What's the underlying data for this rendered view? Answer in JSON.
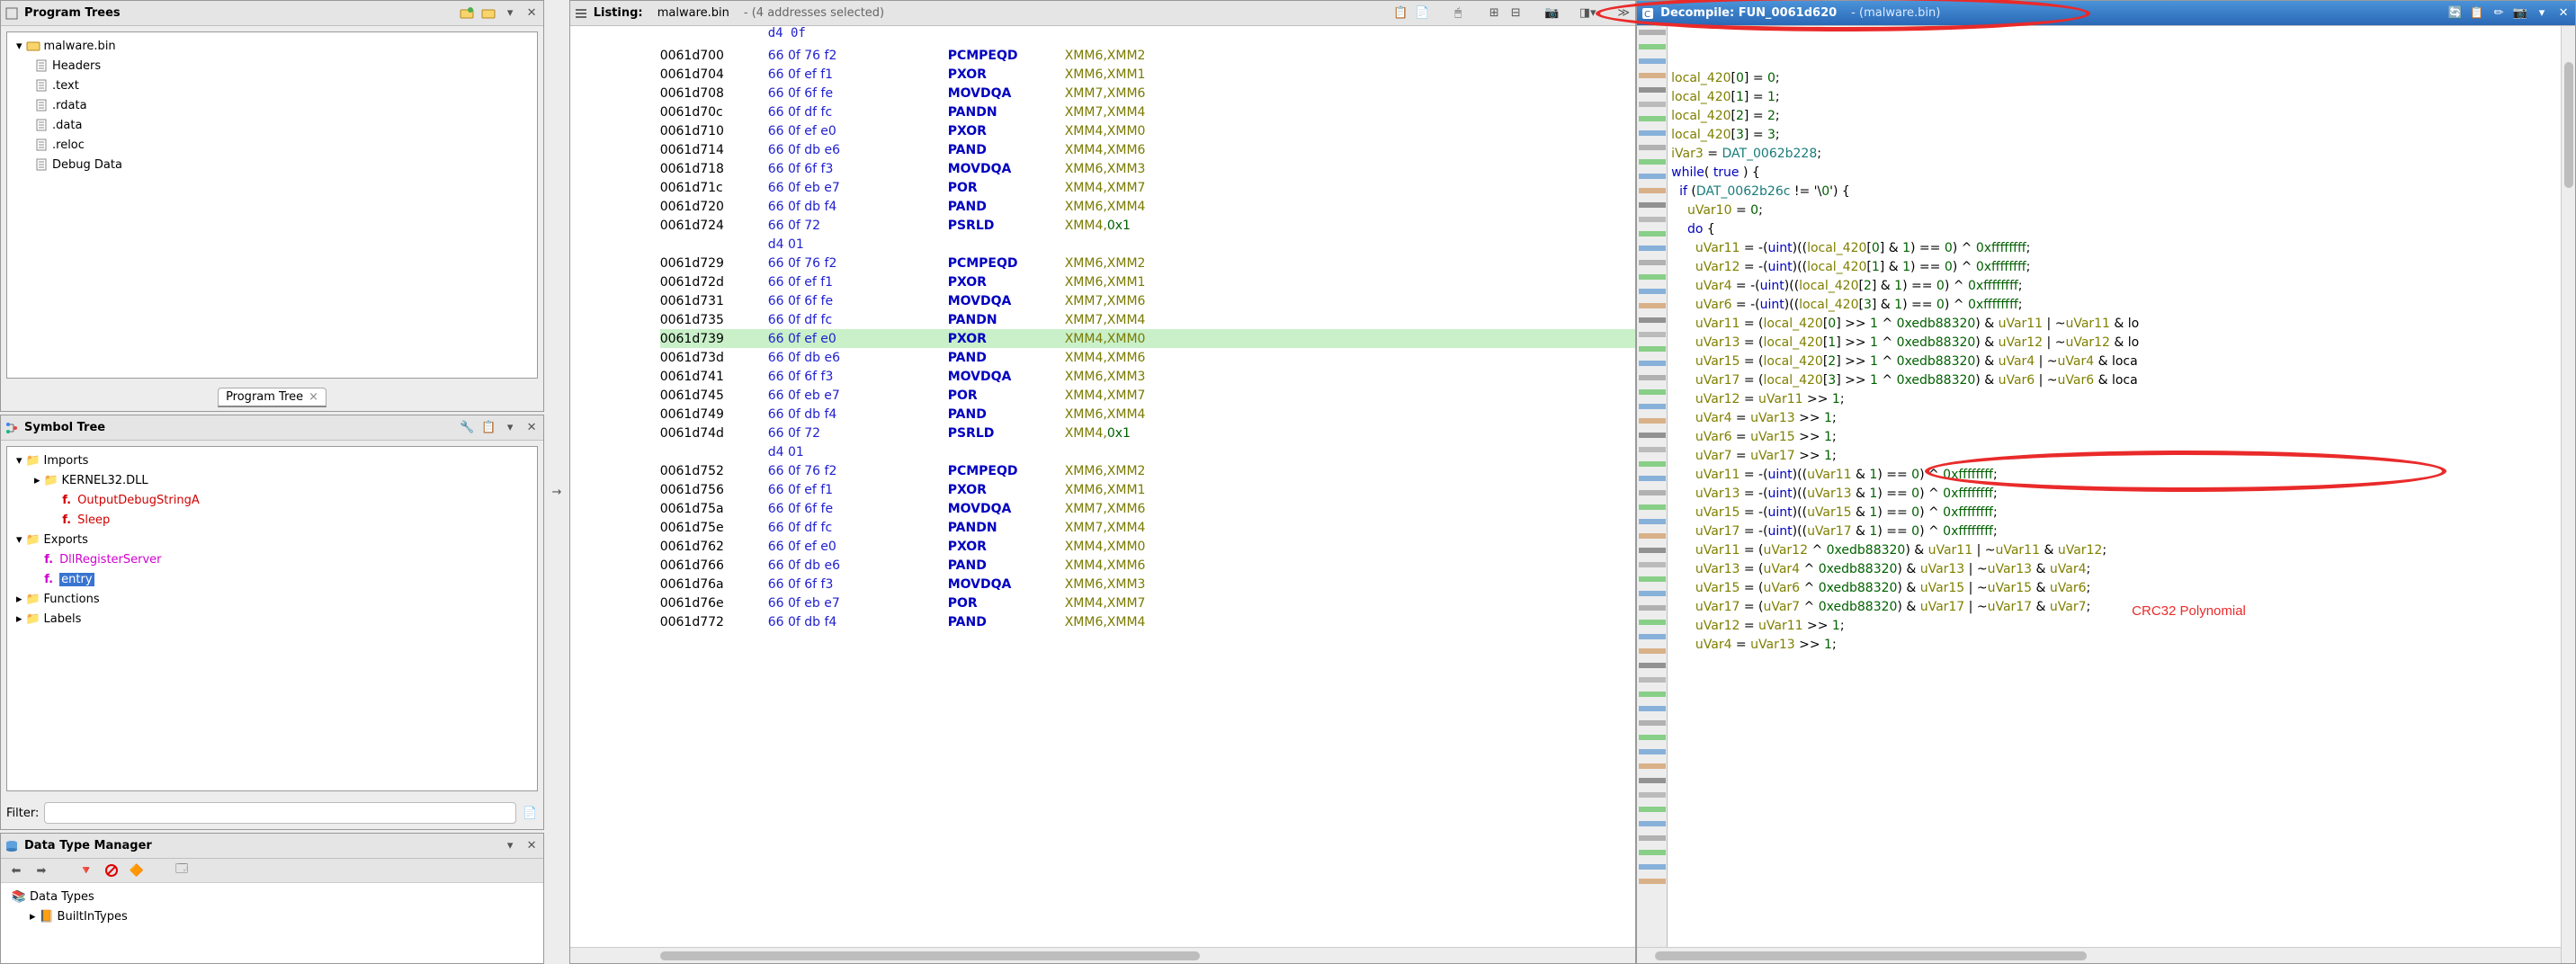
{
  "left": {
    "program_trees": {
      "title": "Program Trees",
      "tab": "Program Tree",
      "root": "malware.bin",
      "items": [
        "Headers",
        ".text",
        ".rdata",
        ".data",
        ".reloc",
        "Debug Data"
      ]
    },
    "symbol_tree": {
      "title": "Symbol Tree",
      "imports": "Imports",
      "k32": "KERNEL32.DLL",
      "k32_fns": [
        "OutputDebugStringA",
        "Sleep"
      ],
      "exports": "Exports",
      "exp_items": [
        "DllRegisterServer",
        "entry"
      ],
      "functions": "Functions",
      "labels": "Labels",
      "filter_label": "Filter:"
    },
    "dtm": {
      "title": "Data Type Manager",
      "root": "Data Types",
      "item": "BuiltInTypes"
    }
  },
  "listing": {
    "title": "Listing:",
    "file": "malware.bin",
    "subtitle": "(4 addresses selected)",
    "top_fragment": "d4 0f",
    "rows": [
      {
        "a": "0061d700",
        "b": "66 0f 76 f2",
        "m": "PCMPEQD",
        "o": "XMM6,XMM2"
      },
      {
        "a": "0061d704",
        "b": "66 0f ef f1",
        "m": "PXOR",
        "o": "XMM6,XMM1"
      },
      {
        "a": "0061d708",
        "b": "66 0f 6f fe",
        "m": "MOVDQA",
        "o": "XMM7,XMM6"
      },
      {
        "a": "0061d70c",
        "b": "66 0f df fc",
        "m": "PANDN",
        "o": "XMM7,XMM4"
      },
      {
        "a": "0061d710",
        "b": "66 0f ef e0",
        "m": "PXOR",
        "o": "XMM4,XMM0"
      },
      {
        "a": "0061d714",
        "b": "66 0f db e6",
        "m": "PAND",
        "o": "XMM4,XMM6"
      },
      {
        "a": "0061d718",
        "b": "66 0f 6f f3",
        "m": "MOVDQA",
        "o": "XMM6,XMM3"
      },
      {
        "a": "0061d71c",
        "b": "66 0f eb e7",
        "m": "POR",
        "o": "XMM4,XMM7"
      },
      {
        "a": "0061d720",
        "b": "66 0f db f4",
        "m": "PAND",
        "o": "XMM6,XMM4"
      },
      {
        "a": "0061d724",
        "b": "66 0f 72",
        "m": "PSRLD",
        "o": "XMM4,0x1"
      },
      {
        "a": "",
        "b": "d4 01",
        "m": "",
        "o": ""
      },
      {
        "a": "0061d729",
        "b": "66 0f 76 f2",
        "m": "PCMPEQD",
        "o": "XMM6,XMM2"
      },
      {
        "a": "0061d72d",
        "b": "66 0f ef f1",
        "m": "PXOR",
        "o": "XMM6,XMM1"
      },
      {
        "a": "0061d731",
        "b": "66 0f 6f fe",
        "m": "MOVDQA",
        "o": "XMM7,XMM6"
      },
      {
        "a": "0061d735",
        "b": "66 0f df fc",
        "m": "PANDN",
        "o": "XMM7,XMM4"
      },
      {
        "a": "0061d739",
        "b": "66 0f ef e0",
        "m": "PXOR",
        "o": "XMM4,XMM0",
        "hl": true
      },
      {
        "a": "0061d73d",
        "b": "66 0f db e6",
        "m": "PAND",
        "o": "XMM4,XMM6"
      },
      {
        "a": "0061d741",
        "b": "66 0f 6f f3",
        "m": "MOVDQA",
        "o": "XMM6,XMM3"
      },
      {
        "a": "0061d745",
        "b": "66 0f eb e7",
        "m": "POR",
        "o": "XMM4,XMM7"
      },
      {
        "a": "0061d749",
        "b": "66 0f db f4",
        "m": "PAND",
        "o": "XMM6,XMM4"
      },
      {
        "a": "0061d74d",
        "b": "66 0f 72",
        "m": "PSRLD",
        "o": "XMM4,0x1"
      },
      {
        "a": "",
        "b": "d4 01",
        "m": "",
        "o": ""
      },
      {
        "a": "0061d752",
        "b": "66 0f 76 f2",
        "m": "PCMPEQD",
        "o": "XMM6,XMM2"
      },
      {
        "a": "0061d756",
        "b": "66 0f ef f1",
        "m": "PXOR",
        "o": "XMM6,XMM1"
      },
      {
        "a": "0061d75a",
        "b": "66 0f 6f fe",
        "m": "MOVDQA",
        "o": "XMM7,XMM6"
      },
      {
        "a": "0061d75e",
        "b": "66 0f df fc",
        "m": "PANDN",
        "o": "XMM7,XMM4"
      },
      {
        "a": "0061d762",
        "b": "66 0f ef e0",
        "m": "PXOR",
        "o": "XMM4,XMM0"
      },
      {
        "a": "0061d766",
        "b": "66 0f db e6",
        "m": "PAND",
        "o": "XMM4,XMM6"
      },
      {
        "a": "0061d76a",
        "b": "66 0f 6f f3",
        "m": "MOVDQA",
        "o": "XMM6,XMM3"
      },
      {
        "a": "0061d76e",
        "b": "66 0f eb e7",
        "m": "POR",
        "o": "XMM4,XMM7"
      },
      {
        "a": "0061d772",
        "b": "66 0f db f4",
        "m": "PAND",
        "o": "XMM6,XMM4"
      }
    ]
  },
  "decompile": {
    "title": "Decompile: FUN_0061d620",
    "subtitle": "(malware.bin)",
    "annotation": "CRC32 Polynomial",
    "lines": [
      "local_420[0] = 0;",
      "local_420[1] = 1;",
      "local_420[2] = 2;",
      "local_420[3] = 3;",
      "iVar3 = DAT_0062b228;",
      "while( true ) {",
      "  if (DAT_0062b26c != '\\0') {",
      "    uVar10 = 0;",
      "    do {",
      "      uVar11 = -(uint)((local_420[0] & 1) == 0) ^ 0xffffffff;",
      "      uVar12 = -(uint)((local_420[1] & 1) == 0) ^ 0xffffffff;",
      "      uVar4 = -(uint)((local_420[2] & 1) == 0) ^ 0xffffffff;",
      "      uVar6 = -(uint)((local_420[3] & 1) == 0) ^ 0xffffffff;",
      "      uVar11 = (local_420[0] >> 1 ^ 0xedb88320) & uVar11 | ~uVar11 & lo",
      "      uVar13 = (local_420[1] >> 1 ^ 0xedb88320) & uVar12 | ~uVar12 & lo",
      "      uVar15 = (local_420[2] >> 1 ^ 0xedb88320) & uVar4 | ~uVar4 & loca",
      "      uVar17 = (local_420[3] >> 1 ^ 0xedb88320) & uVar6 | ~uVar6 & loca",
      "      uVar12 = uVar11 >> 1;",
      "      uVar4 = uVar13 >> 1;",
      "      uVar6 = uVar15 >> 1;",
      "      uVar7 = uVar17 >> 1;",
      "      uVar11 = -(uint)((uVar11 & 1) == 0) ^ 0xffffffff;",
      "      uVar13 = -(uint)((uVar13 & 1) == 0) ^ 0xffffffff;",
      "      uVar15 = -(uint)((uVar15 & 1) == 0) ^ 0xffffffff;",
      "      uVar17 = -(uint)((uVar17 & 1) == 0) ^ 0xffffffff;",
      "      uVar11 = (uVar12 ^ 0xedb88320) & uVar11 | ~uVar11 & uVar12;",
      "      uVar13 = (uVar4 ^ 0xedb88320) & uVar13 | ~uVar13 & uVar4;",
      "      uVar15 = (uVar6 ^ 0xedb88320) & uVar15 | ~uVar15 & uVar6;",
      "      uVar17 = (uVar7 ^ 0xedb88320) & uVar17 | ~uVar17 & uVar7;",
      "      uVar12 = uVar11 >> 1;",
      "      uVar4 = uVar13 >> 1;"
    ]
  }
}
